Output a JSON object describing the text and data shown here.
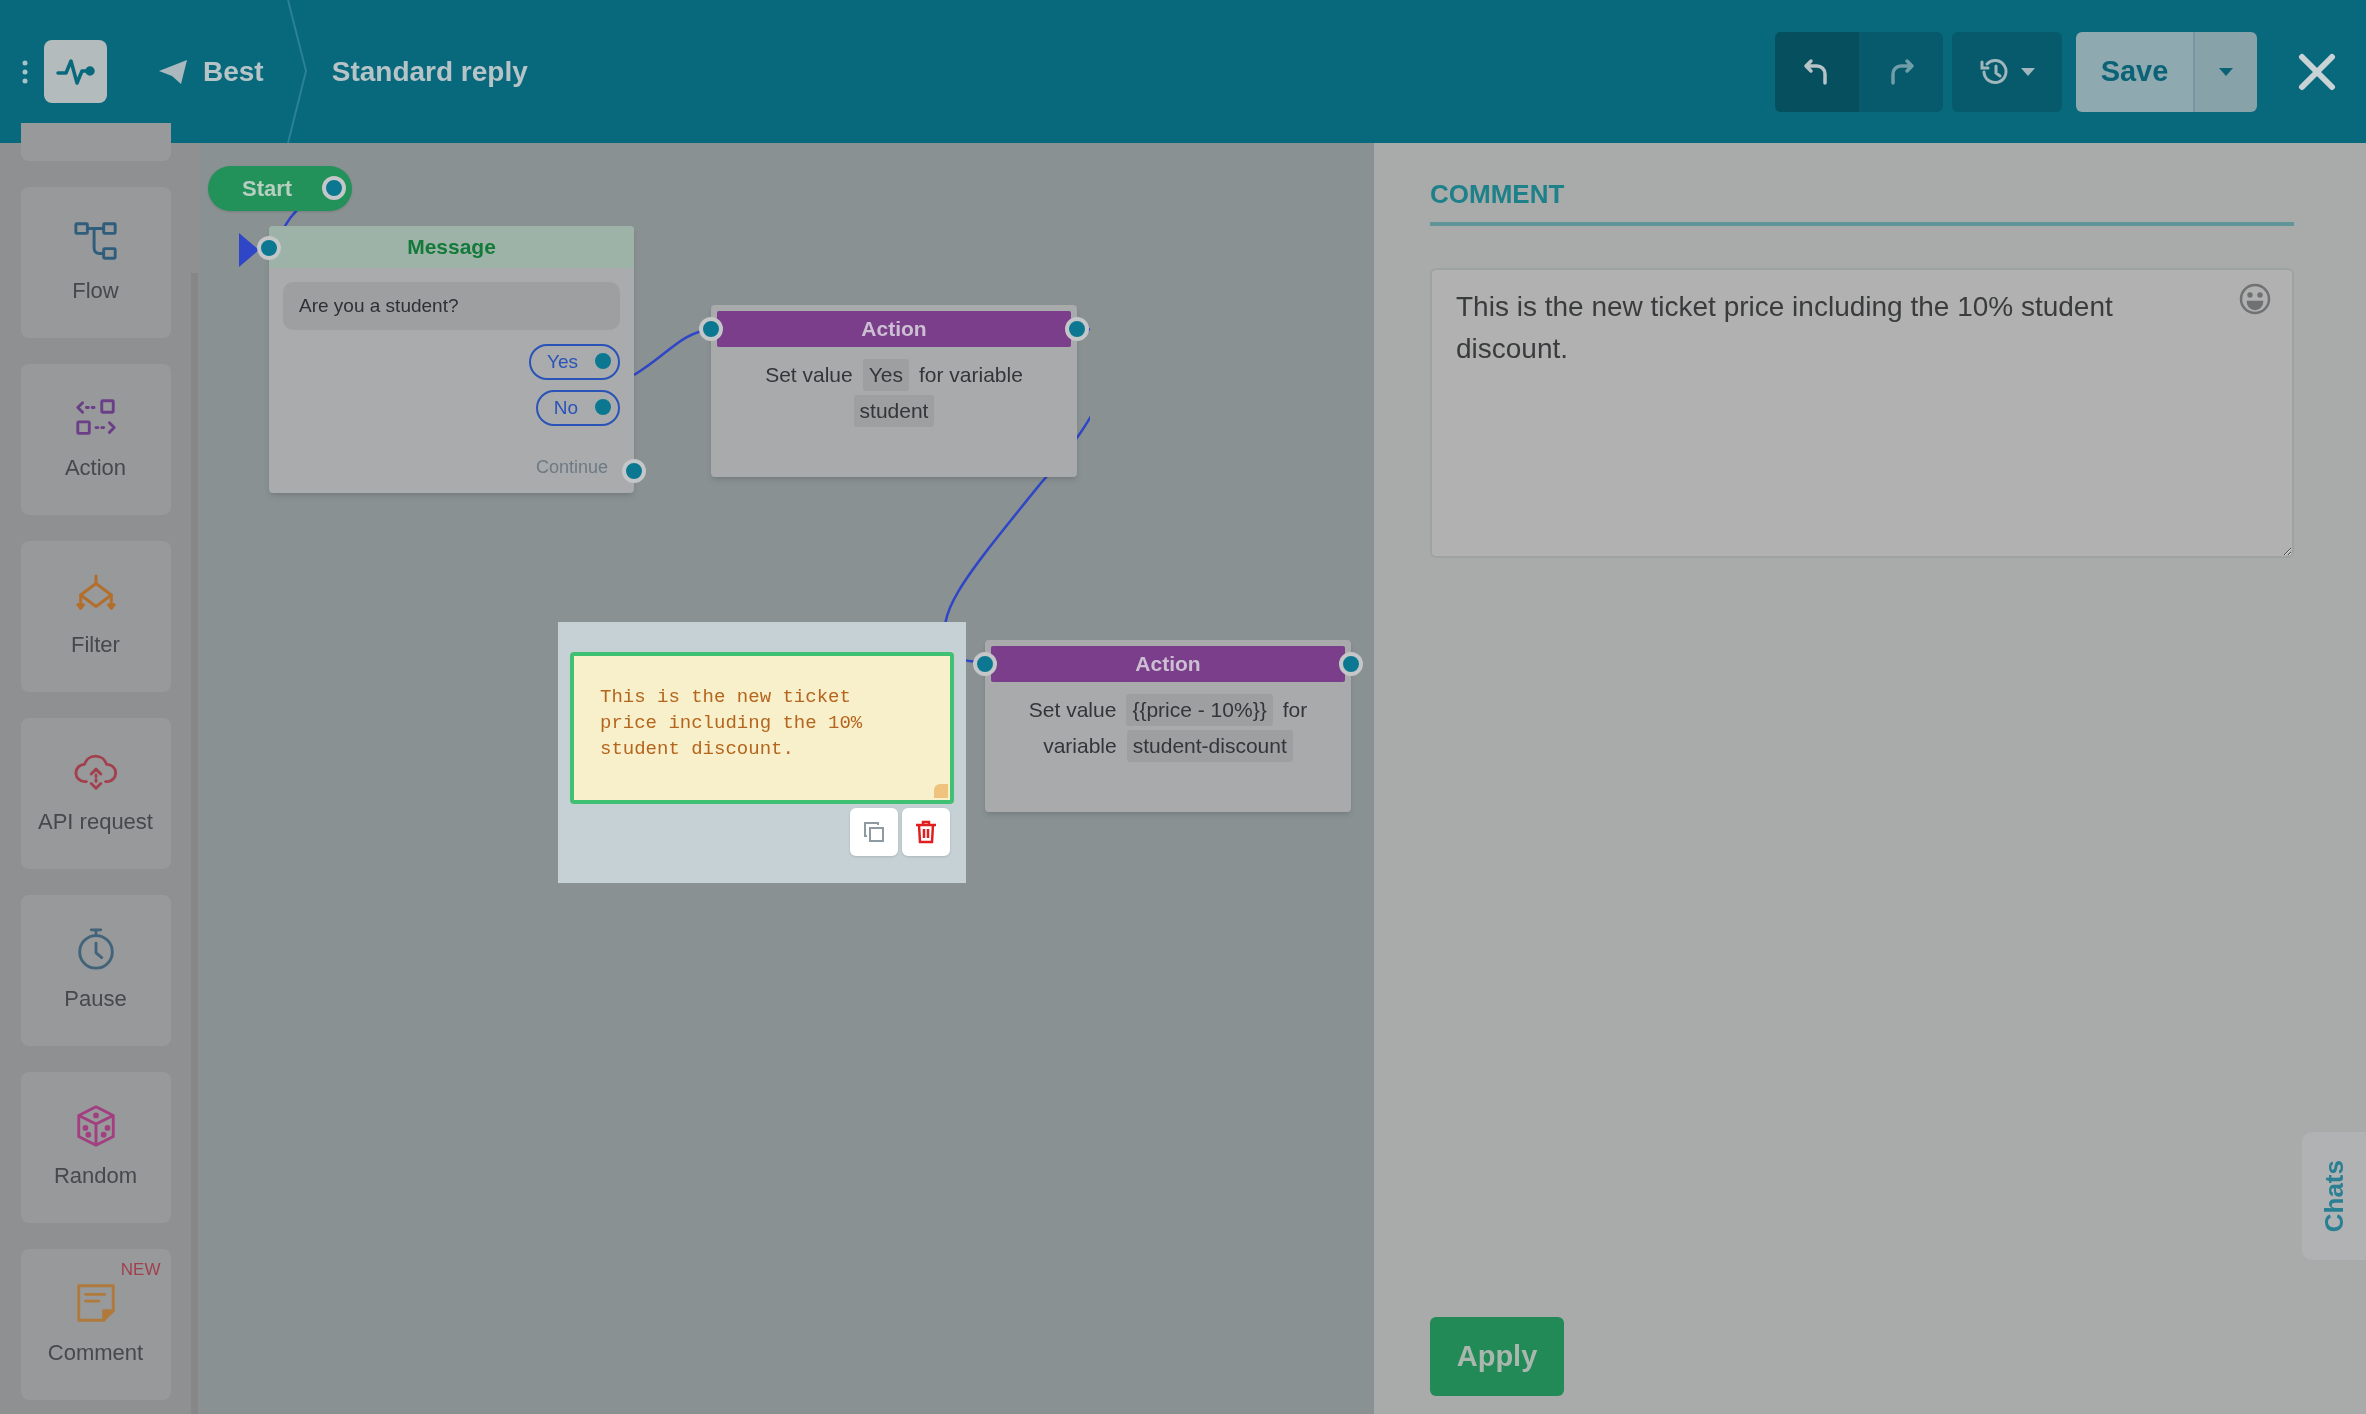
{
  "header": {
    "breadcrumbs": [
      {
        "label": "Best"
      },
      {
        "label": "Standard reply"
      }
    ],
    "save_label": "Save"
  },
  "sidebar": {
    "items": [
      {
        "kind": "flow",
        "label": "Flow"
      },
      {
        "kind": "action",
        "label": "Action"
      },
      {
        "kind": "filter",
        "label": "Filter"
      },
      {
        "kind": "api",
        "label": "API request"
      },
      {
        "kind": "pause",
        "label": "Pause"
      },
      {
        "kind": "random",
        "label": "Random"
      },
      {
        "kind": "comment",
        "label": "Comment",
        "badge": "NEW"
      }
    ]
  },
  "canvas": {
    "start": {
      "label": "Start"
    },
    "message": {
      "title": "Message",
      "text": "Are you a student?",
      "options": [
        {
          "label": "Yes"
        },
        {
          "label": "No"
        }
      ],
      "continue_label": "Continue"
    },
    "actions": [
      {
        "title": "Action",
        "parts": [
          {
            "kind": "text",
            "text": "Set value"
          },
          {
            "kind": "token",
            "text": "Yes"
          },
          {
            "kind": "text",
            "text": "for variable"
          },
          {
            "kind": "token",
            "text": "student"
          }
        ]
      },
      {
        "title": "Action",
        "parts": [
          {
            "kind": "text",
            "text": "Set value"
          },
          {
            "kind": "token",
            "text": "{{price - 10%}}"
          },
          {
            "kind": "text",
            "text": "for"
          },
          {
            "kind": "text",
            "text": "variable"
          },
          {
            "kind": "token",
            "text": "student-discount"
          }
        ]
      }
    ],
    "comment_note": {
      "text": "This is the new ticket price including the 10% student discount."
    }
  },
  "panel": {
    "title": "COMMENT",
    "value": "This is the new ticket price including the 10% student discount.",
    "apply_label": "Apply"
  },
  "chats_tab": {
    "label": "Chats"
  }
}
